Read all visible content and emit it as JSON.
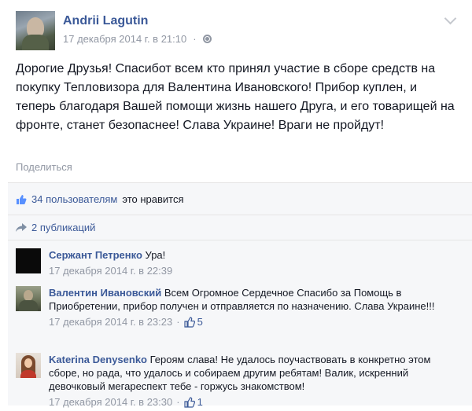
{
  "post": {
    "author": "Andrii Lagutin",
    "timestamp": "17 декабря 2014 г. в 21:10",
    "separator": "·",
    "text": "Дорогие Друзья! Спасибот всем кто принял участие в сборе средств на покупку Тепловизора для Валентина Ивановского! Прибор куплен, и теперь благодаря Вашей помощи жизнь нашего Друга, и его товарищей на фронте, станет безопаснее! Слава Украине! Враги не пройдут!",
    "share_label": "Поделиться"
  },
  "likes": {
    "text": "34 пользователям",
    "suffix": "это нравится"
  },
  "shares": {
    "text": "2 публикаций"
  },
  "comments": [
    {
      "author": "Сержант Петренко",
      "text": "Ура!",
      "timestamp": "17 декабря 2014 г. в 22:39",
      "likes": ""
    },
    {
      "author": "Валентин Ивановский",
      "text": "Всем Огромное Сердечное Спасибо за Помощь в Приобретении, прибор получен и отправляется по назначению. Слава Украине!!!",
      "timestamp": "17 декабря 2014 г. в 23:23",
      "likes": "5"
    },
    {
      "author": "Katerina Denysenko",
      "text": "Героям слава! Не удалось поучаствовать в конкретно этом сборе, но рада, что удалось и собираем другим ребятам! Валик, искренний девочковый мегареспект тебе - горжусь знакомством!",
      "timestamp": "17 декабря 2014 г. в 23:30",
      "likes": "1"
    }
  ],
  "icons": {
    "header_privacy": "globe-icon",
    "options": "chevron-down-icon",
    "likes": "thumbs-up-icon",
    "shares": "share-arrow-icon",
    "comment_like": "thumbs-up-icon"
  },
  "colors": {
    "link": "#3b5998",
    "meta": "#9197a3",
    "ufi_bg": "#f6f7f9"
  }
}
